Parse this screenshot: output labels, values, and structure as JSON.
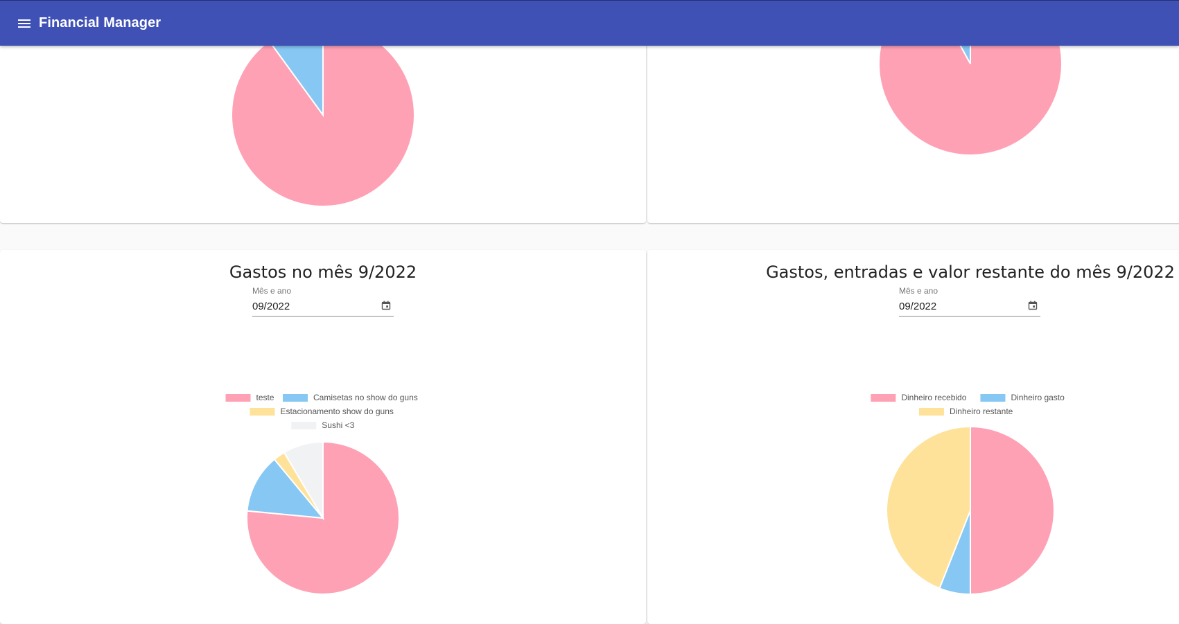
{
  "app": {
    "title": "Financial Manager"
  },
  "colors": {
    "pink": "#ffa1b5",
    "blue": "#86c7f3",
    "yellow": "#ffe29a",
    "gray": "#f1f2f4"
  },
  "cards": [
    {
      "title": "Gastos no mês 9/2022",
      "field_label": "Mês e ano",
      "field_value": "09/2022",
      "legend": [
        {
          "label": "teste",
          "color": "#ffa1b5"
        },
        {
          "label": "Camisetas no show do guns",
          "color": "#86c7f3"
        },
        {
          "label": "Estacionamento show do guns",
          "color": "#ffe29a"
        },
        {
          "label": "Sushi <3",
          "color": "#f1f2f4"
        }
      ],
      "chart_data": {
        "type": "pie",
        "values": [
          76.5,
          12.5,
          2.5,
          8.5
        ]
      }
    },
    {
      "title": "Gastos, entradas e valor restante do mês 9/2022",
      "field_label": "Mês e ano",
      "field_value": "09/2022",
      "legend": [
        {
          "label": "Dinheiro recebido",
          "color": "#ffa1b5"
        },
        {
          "label": "Dinheiro gasto",
          "color": "#86c7f3"
        },
        {
          "label": "Dinheiro restante",
          "color": "#ffe29a"
        }
      ],
      "chart_data": {
        "type": "pie",
        "values": [
          50,
          6,
          44
        ]
      }
    }
  ],
  "top_charts": [
    {
      "chart_data": {
        "type": "pie",
        "values": [
          90,
          10
        ]
      }
    },
    {
      "chart_data": {
        "type": "pie",
        "values": [
          92,
          8
        ]
      }
    }
  ]
}
